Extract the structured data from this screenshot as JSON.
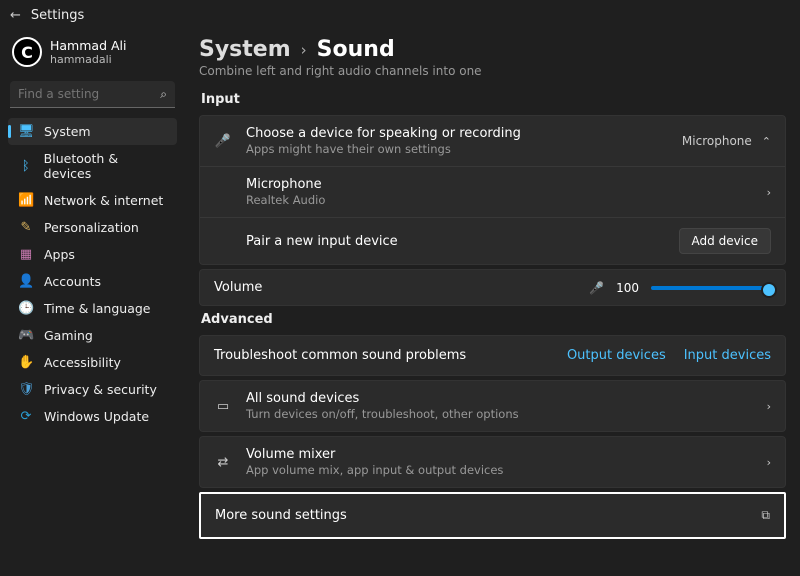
{
  "header": {
    "back": "←",
    "title": "Settings"
  },
  "profile": {
    "name": "Hammad Ali",
    "user": "hammadali",
    "initial": "C"
  },
  "search": {
    "placeholder": "Find a setting"
  },
  "nav": [
    {
      "icon": "🖥",
      "label": "System",
      "cls": "c-blue",
      "active": true
    },
    {
      "icon": "ᛒ",
      "label": "Bluetooth & devices",
      "cls": "c-blue"
    },
    {
      "icon": "📶",
      "label": "Network & internet",
      "cls": "c-teal"
    },
    {
      "icon": "✎",
      "label": "Personalization",
      "cls": "c-yel"
    },
    {
      "icon": "▦",
      "label": "Apps",
      "cls": "c-pink"
    },
    {
      "icon": "👤",
      "label": "Accounts",
      "cls": "c-cyan"
    },
    {
      "icon": "🕒",
      "label": "Time & language",
      "cls": "c-grn"
    },
    {
      "icon": "🎮",
      "label": "Gaming",
      "cls": "c-teal"
    },
    {
      "icon": "✋",
      "label": "Accessibility",
      "cls": "c-cyan"
    },
    {
      "icon": "🛡",
      "label": "Privacy & security",
      "cls": "c-lock"
    },
    {
      "icon": "⟳",
      "label": "Windows Update",
      "cls": "c-upd"
    }
  ],
  "breadcrumb": {
    "root": "System",
    "sep": "›",
    "page": "Sound"
  },
  "top_desc": "Combine left and right audio channels into one",
  "input_section": "Input",
  "input_card": {
    "choose": {
      "title": "Choose a device for speaking or recording",
      "desc": "Apps might have their own settings",
      "right": "Microphone"
    },
    "device": {
      "title": "Microphone",
      "desc": "Realtek Audio"
    },
    "pair": {
      "title": "Pair a new input device",
      "btn": "Add device"
    }
  },
  "volume": {
    "label": "Volume",
    "value": "100"
  },
  "advanced_section": "Advanced",
  "troubleshoot": {
    "title": "Troubleshoot common sound problems",
    "out": "Output devices",
    "in": "Input devices"
  },
  "all_devices": {
    "title": "All sound devices",
    "desc": "Turn devices on/off, troubleshoot, other options"
  },
  "mixer": {
    "title": "Volume mixer",
    "desc": "App volume mix, app input & output devices"
  },
  "more": {
    "title": "More sound settings"
  }
}
